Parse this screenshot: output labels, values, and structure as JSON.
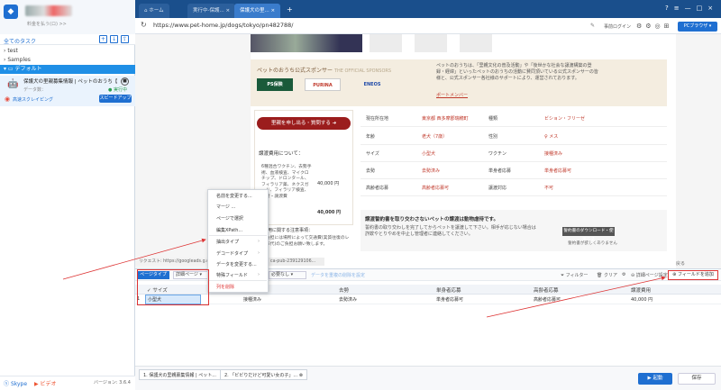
{
  "app": {
    "balance_text": "料金を払う(ロ)  >>",
    "all_tasks": "全てのタスク",
    "tree": [
      "test",
      "Samples"
    ],
    "default_folder": "デフォルト",
    "task": {
      "name": "保護犬の里親募集情報 | ペットのおうち【...",
      "data_label": "データ数：",
      "status": "● 実行中",
      "scrape_label": "高速スクレイピング",
      "speed_button": "スピードアップ"
    },
    "footer": {
      "skype": "Skype",
      "video": "ビデオ",
      "version": "バージョン: 3.6.4"
    }
  },
  "browser": {
    "tabs": [
      "ホーム",
      "実行中-保護...",
      "保護犬の里..."
    ],
    "url": "https://www.pet-home.jp/dogs/tokyo/pn482788/",
    "login_label": "事前ログイン",
    "pc_browser": "PCブラウザ"
  },
  "webpage": {
    "sponsor_title": "ペットのおうち公式スポンサー",
    "sponsor_sub": "THE OFFICIAL SPONSORS",
    "sponsor_text": "ペットのおうちは、「里親文化の普及活動」や「後世かな社会な譲渡構築の登録・経緯」といったペットのおうちの活動に賛同頂いている公式スポンサーの皆様と、公式スポンサー各社様のサポートにより、運営されております。",
    "sponsor_link": "ポートメンバー",
    "logos": [
      "PS保険",
      "PURINA",
      "ENEOS"
    ],
    "inquiry_button": "里親を申し出る・質問する",
    "fee_title": "譲渡費用について：",
    "fee_items": "6種混合ワクチン、去勢手術、血液検査、マイクロチップ、ドロンタール、フィラリア薬、ネクスガード、フィラリア検査、寄付・譲渡費",
    "fee_value": "40,000 円",
    "fee_total_label": "合計",
    "fee_total": "40,000 円",
    "caution_title": "・費用に関する注意事項：",
    "caution_text": "・負担には場所によって交通費(実質往復のレンバ代)のご負担お願い致します。",
    "rows": [
      {
        "l1": "現在所在地",
        "v1": "東京都 西多摩郡瑞穂町",
        "l2": "種類",
        "v2": "ビション・フリーゼ"
      },
      {
        "l1": "年齢",
        "v1": "老犬（7歳）",
        "l2": "性別",
        "v2": "♀ メス"
      },
      {
        "l1": "サイズ",
        "v1": "小型犬",
        "l2": "ワクチン",
        "v2": "接種済み"
      },
      {
        "l1": "去勢",
        "v1": "去勢済み",
        "l2": "単身者応募",
        "v2": "単身者応募可"
      },
      {
        "l1": "高齢者応募",
        "v1": "高齢者応募可",
        "l2": "譲渡対応",
        "v2": "不可"
      }
    ],
    "notice_title": "譲渡誓約書を取り交わさないペットの譲渡は動物虐待です。",
    "notice_text": "誓約書の取り交わしを完了してからペットを譲渡して下さい。相手が応じない場合は詐欺やとりやめを中止し管理者に連絡してください。",
    "download_button": "誓約書のダウンロード・使用方法",
    "no_download": "誓約書が欲しくありません",
    "back_top": "戻る"
  },
  "request_bar": {
    "left": "リクエスト: https://googleads.g.doubleclick...",
    "right": "ca-pub-239129106..."
  },
  "data_panel": {
    "page_type": "ページタイプ",
    "detail_page": "詳細ページ",
    "needed": "必要なし",
    "dedup": "データを重複の削除を設定",
    "filter": "フィルター",
    "clear": "クリア",
    "detail_settings": "詳細ページ設定",
    "add_field": "フィールドを追加",
    "headers": [
      "サイズ",
      "去勢",
      "単身者応募",
      "高齢者応募",
      "譲渡費用"
    ],
    "row": {
      "index": "1",
      "c0": "小型犬",
      "c0b": "接種済み",
      "c1": "去勢済み",
      "c2": "単身者応募可",
      "c3": "高齢者応募可",
      "c4": "40,000 円"
    }
  },
  "context_menu": {
    "items": [
      "名前を変更する...",
      "マージ ...",
      "ページで選択",
      "編集XPath...",
      "抽出タイプ",
      "デコードタイプ",
      "データを変更する...",
      "特殊フィールド",
      "列を削除"
    ]
  },
  "bottom": {
    "tab1": "1. 保護犬の里親募集情報 | ペット...",
    "tab2": "2. 「ビビりだけど可愛い女の子」...",
    "run": "起動",
    "save": "保存"
  },
  "colors": {
    "primary": "#1f6fd1",
    "accent_red": "#d33",
    "tab_bar": "#1a4f8c"
  }
}
